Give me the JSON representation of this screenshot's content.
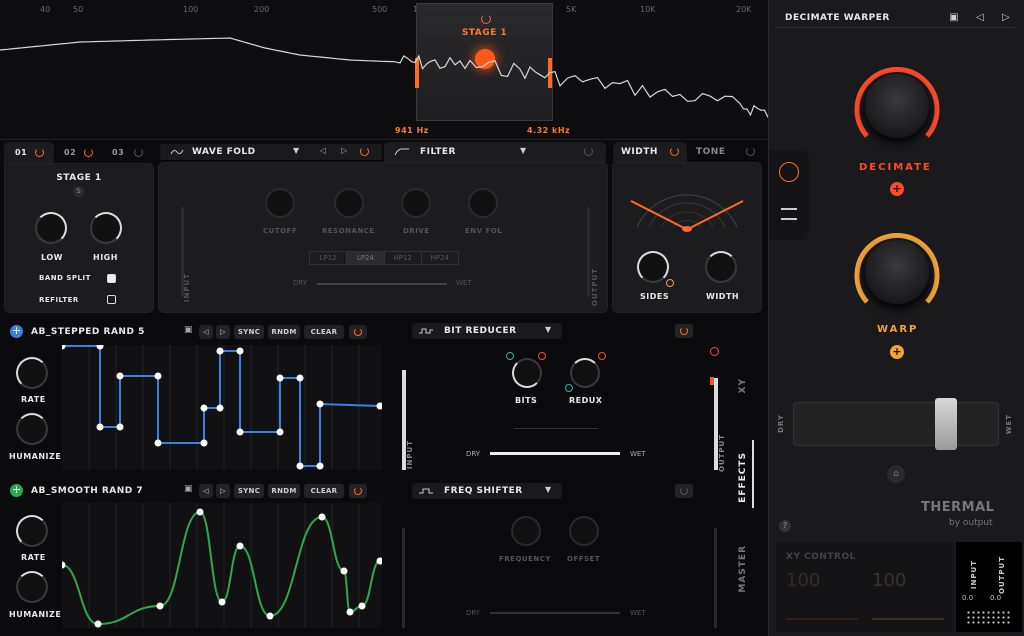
{
  "spectrum": {
    "ticks": [
      "40",
      "50",
      "100",
      "200",
      "500",
      "1K",
      "2K",
      "5K",
      "10K",
      "20K"
    ],
    "stage_label": "STAGE 1",
    "low_freq": "941 Hz",
    "high_freq": "4.32 kHz"
  },
  "stages": {
    "tabs": [
      "01",
      "02",
      "03"
    ],
    "title": "STAGE 1",
    "solo": "S",
    "low_label": "LOW",
    "high_label": "HIGH",
    "band_split": "BAND SPLIT",
    "refilter": "REFILTER"
  },
  "wavefold": {
    "name": "WAVE FOLD"
  },
  "filter": {
    "name": "FILTER",
    "knobs": [
      "CUTOFF",
      "RESONANCE",
      "DRIVE",
      "ENV FOL"
    ],
    "modes": [
      "LP12",
      "LP24",
      "HP12",
      "HP24"
    ],
    "selected_mode": "LP24",
    "dry": "DRY",
    "wet": "WET",
    "input": "INPUT",
    "output": "OUTPUT"
  },
  "width": {
    "tab": "WIDTH",
    "tab2": "TONE",
    "sides": "SIDES",
    "width_label": "WIDTH"
  },
  "mod1": {
    "name": "AB_STEPPED RAND 5",
    "sync": "SYNC",
    "rndm": "RNDM",
    "clear": "CLEAR",
    "rate": "RATE",
    "humanize": "HUMANIZE",
    "color": "#3b82e0"
  },
  "mod2": {
    "name": "AB_SMOOTH RAND 7",
    "sync": "SYNC",
    "rndm": "RNDM",
    "clear": "CLEAR",
    "rate": "RATE",
    "humanize": "HUMANIZE",
    "color": "#2ea84e"
  },
  "bitreducer": {
    "name": "BIT REDUCER",
    "bits": "BITS",
    "redux": "REDUX",
    "dry": "DRY",
    "wet": "WET",
    "input": "INPUT",
    "output": "OUTPUT"
  },
  "freqshifter": {
    "name": "FREQ SHIFTER",
    "frequency": "FREQUENCY",
    "offset": "OFFSET",
    "dry": "DRY",
    "wet": "WET"
  },
  "side_tabs": {
    "xy": "XY",
    "effects": "EFFECTS",
    "master": "MASTER"
  },
  "preset": {
    "name": "DECIMATE WARPER",
    "macro1": "DECIMATE",
    "macro2": "WARP",
    "dry": "DRY",
    "wet": "WET",
    "brand": "THERMAL",
    "brand_sub": "by output"
  },
  "xy_control": {
    "title": "XY CONTROL",
    "val1": "100",
    "val2": "100",
    "input": "INPUT",
    "output": "OUTPUT",
    "in_val": "0.0",
    "out_val": "0.0"
  }
}
